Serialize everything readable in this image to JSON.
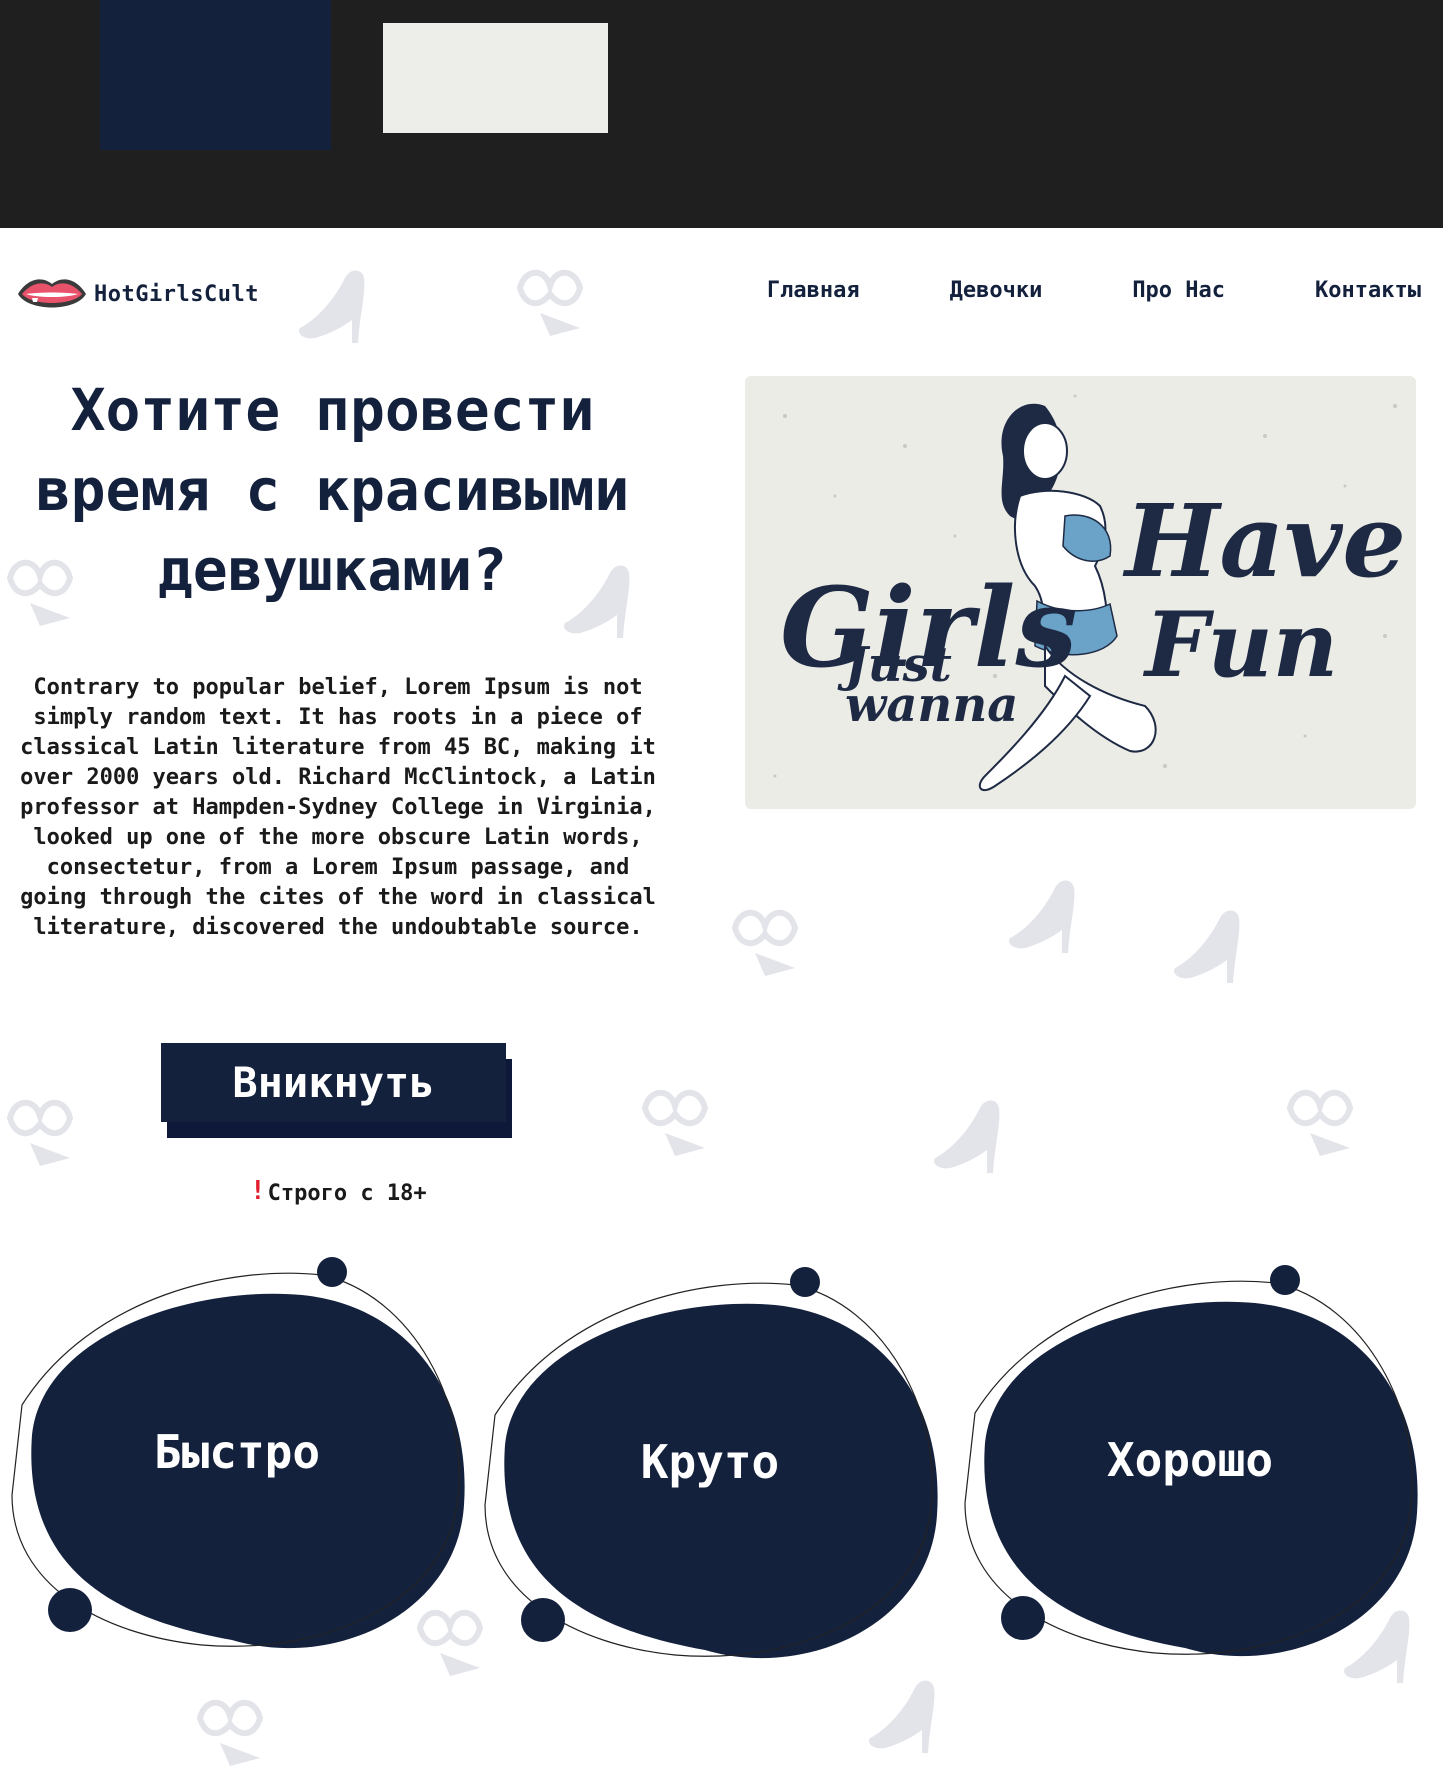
{
  "brand": {
    "name": "HotGirlsCult",
    "logo_icon": "lips-icon"
  },
  "nav": {
    "items": [
      {
        "label": "Главная"
      },
      {
        "label": "Девочки"
      },
      {
        "label": "Про Нас"
      },
      {
        "label": "Контакты"
      }
    ]
  },
  "hero": {
    "title": "Хотите провести время с красивыми девушками?",
    "text": "Contrary to popular belief, Lorem Ipsum is not simply random text. It has roots in a piece of classical Latin literature from 45 BC, making it over 2000 years old. Richard McClintock, a Latin professor at Hampden-Sydney College in Virginia, looked up one of the more obscure Latin words, consectetur, from a Lorem Ipsum passage, and going through the cites of the word in classical literature, discovered the undoubtable source.",
    "cta_label": "Вникнуть",
    "age_icon": "exclamation-icon",
    "age_mark": "!",
    "age_note": "Строго с 18+"
  },
  "hero_image": {
    "lettering": [
      "Girls",
      "Just",
      "wanna",
      "Have",
      "Fun"
    ]
  },
  "features": [
    {
      "label": "Быстро"
    },
    {
      "label": "Круто"
    },
    {
      "label": "Хорошо"
    }
  ],
  "colors": {
    "navy": "#14213d",
    "topbar": "#1f1f1f",
    "light_swatch": "#edeee9",
    "accent_red": "#e0202f",
    "figure_blue": "#6aa3c7"
  }
}
